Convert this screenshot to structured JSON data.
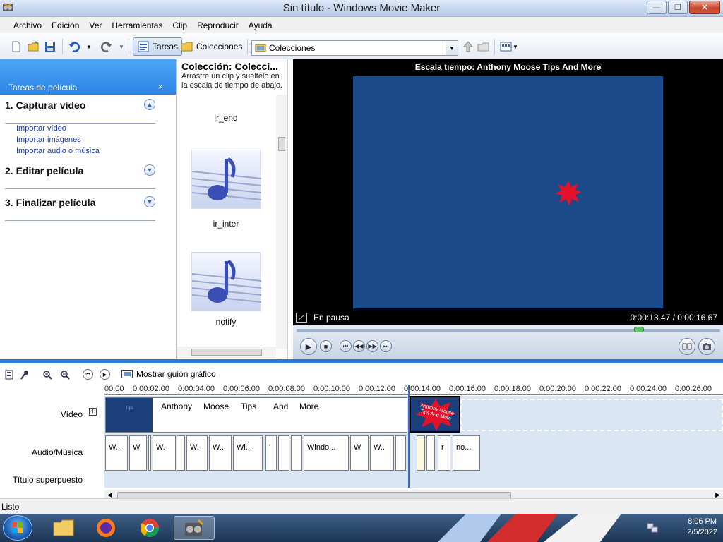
{
  "window": {
    "title": "Sin título - Windows Movie Maker",
    "minimize": "—",
    "maximize": "❐",
    "close": "✕"
  },
  "menu": [
    "Archivo",
    "Edición",
    "Ver",
    "Herramientas",
    "Clip",
    "Reproducir",
    "Ayuda"
  ],
  "toolbar": {
    "tasks_label": "Tareas",
    "collections_label": "Colecciones",
    "collections_combo_value": "Colecciones"
  },
  "taskpane": {
    "header": "Tareas de película",
    "close": "×",
    "sections": [
      {
        "title": "1. Capturar vídeo",
        "expanded": true,
        "links": [
          "Importar vídeo",
          "Importar imágenes",
          "Importar audio o música"
        ]
      },
      {
        "title": "2. Editar película",
        "expanded": false,
        "links": []
      },
      {
        "title": "3. Finalizar película",
        "expanded": false,
        "links": []
      }
    ]
  },
  "collection": {
    "title": "Colección: Colecci...",
    "description": "Arrastre un clip y suéltelo en la escala de tiempo de abajo.",
    "clips": [
      "ir_end",
      "ir_inter",
      "notify"
    ]
  },
  "preview": {
    "title": "Escala tiempo: Anthony Moose Tips And More",
    "status": "En pausa",
    "time": "0:00:13.47 / 0:00:16.67",
    "progress": 0.808
  },
  "timeline": {
    "storyboard_label": "Mostrar guión gráfico",
    "ruler": [
      "00.00",
      "0:00:02.00",
      "0:00:04.00",
      "0:00:06.00",
      "0:00:08.00",
      "0:00:10.00",
      "0:00:12.00",
      "0:00:14.00",
      "0:00:16.00",
      "0:00:18.00",
      "0:00:20.00",
      "0:00:22.00",
      "0:00:24.00",
      "0:00:26.00"
    ],
    "tracks": {
      "video": "Vídeo",
      "audio": "Audio/Música",
      "title": "Título superpuesto"
    },
    "video_clip_words": [
      "Tips",
      "Anthony",
      "Moose",
      "Tips",
      "And",
      "More"
    ],
    "audio_clips": [
      "W...",
      "W",
      "W.",
      "",
      "W.",
      "W..",
      "Wi...",
      "'",
      "",
      "",
      "Windo...",
      "W",
      "W..",
      "",
      "",
      "",
      "r",
      "no..."
    ],
    "dragged_clip_text": "Anthony Moose Tips And More"
  },
  "statusbar": "Listo",
  "taskbar": {
    "time": "8:06 PM",
    "date": "2/5/2022"
  }
}
